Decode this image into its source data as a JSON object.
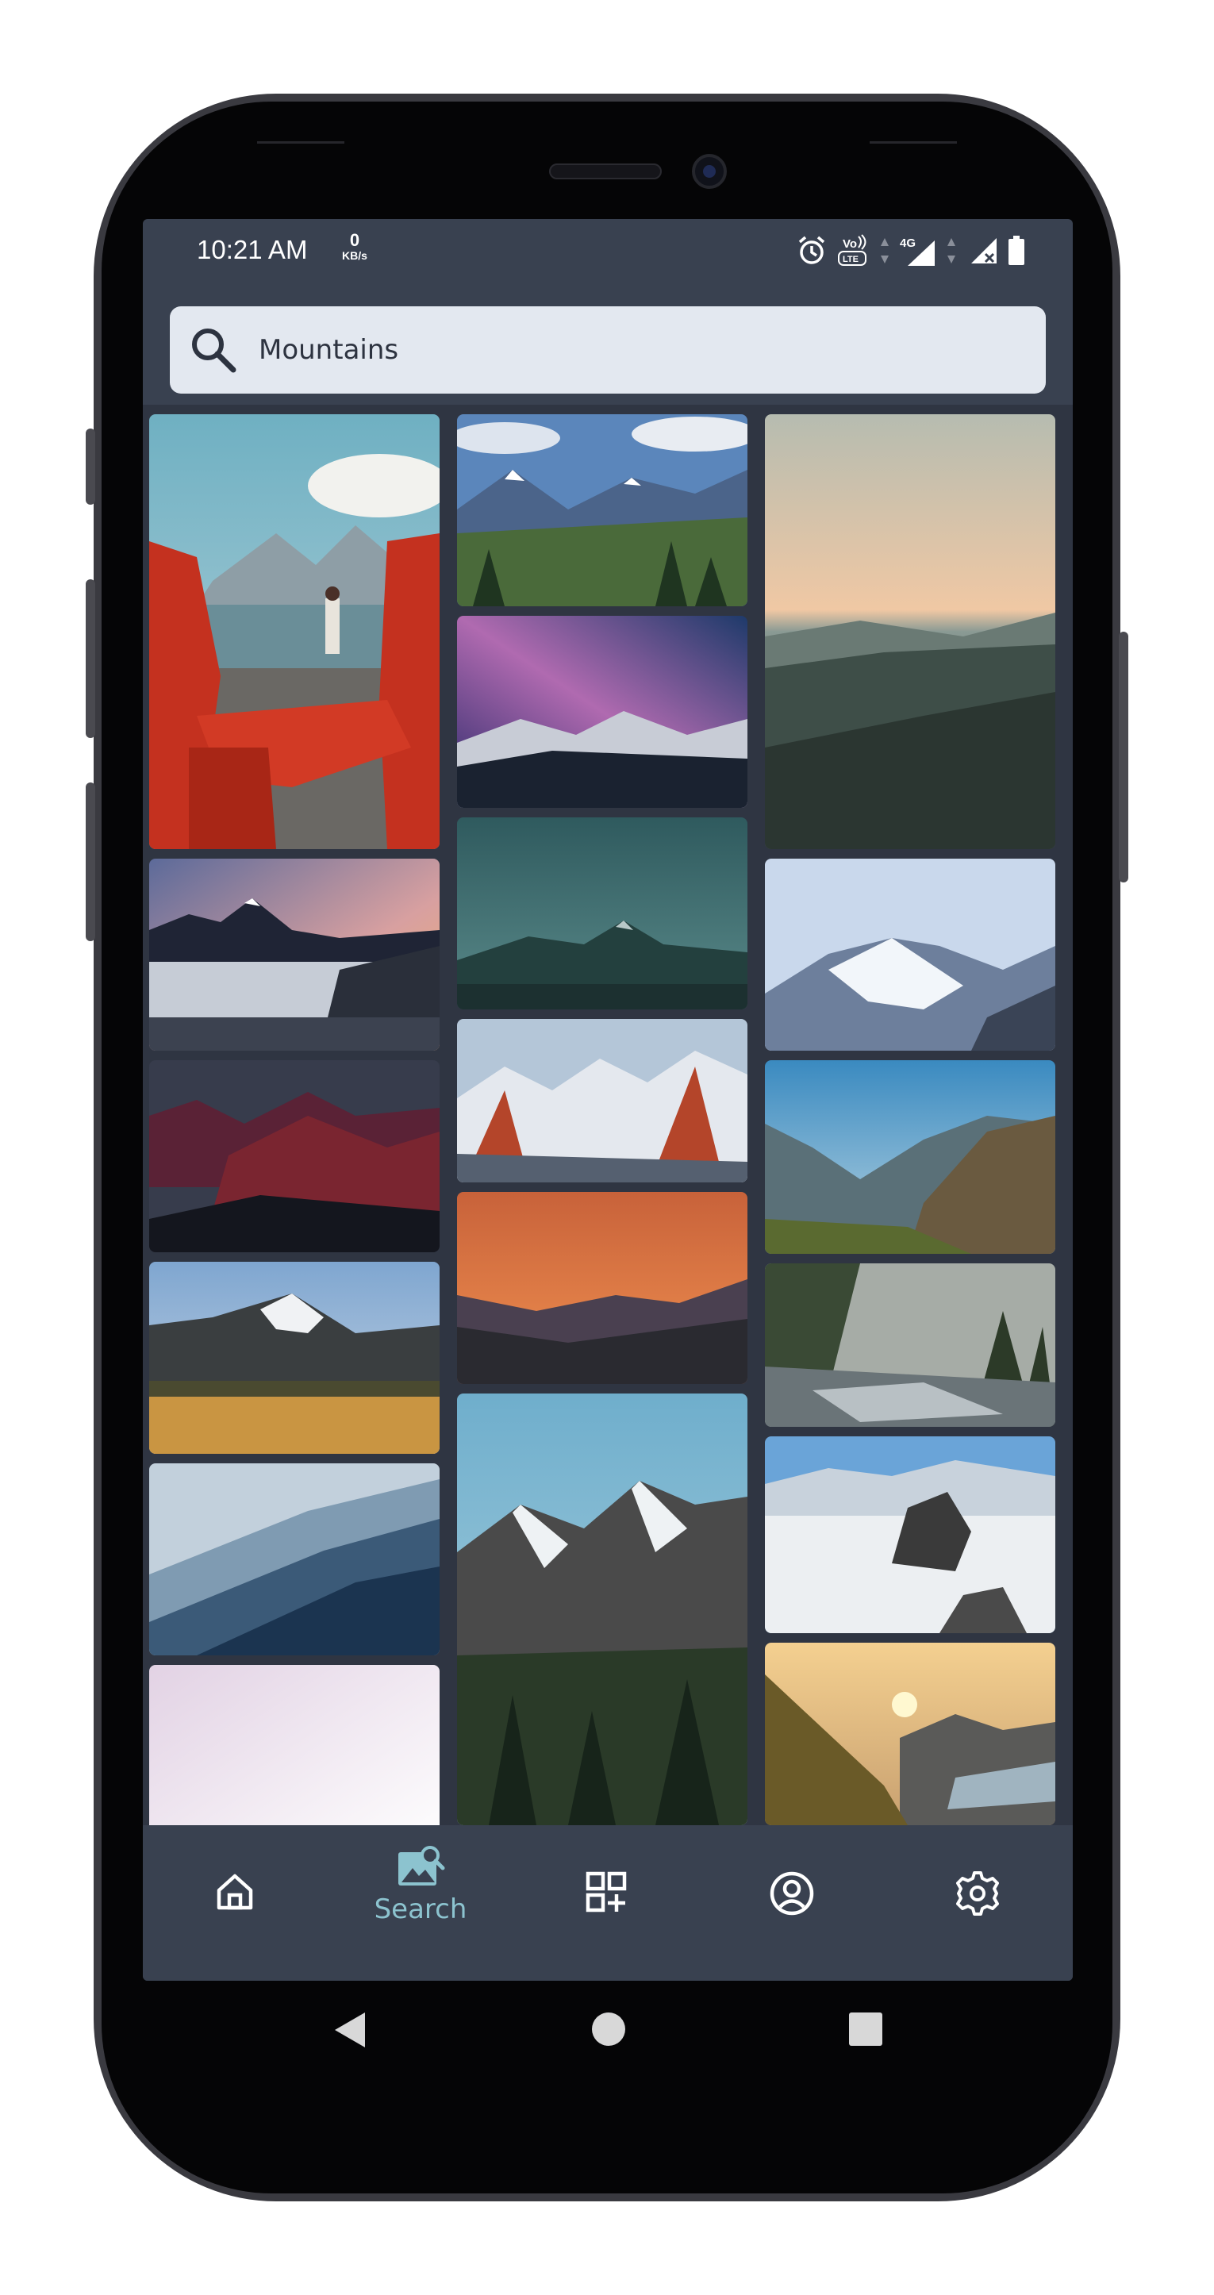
{
  "status_bar": {
    "time": "10:21 AM",
    "data_rate": "0",
    "data_rate_unit": "KB/s",
    "network": "4G"
  },
  "search": {
    "value": "Mountains",
    "placeholder": "Search"
  },
  "results": [
    {
      "id": "canoe-chairs-lake-person",
      "colors": [
        "#7fb3c2",
        "#c9362a"
      ]
    },
    {
      "id": "blue-valley-forest",
      "colors": [
        "#5f8bbf",
        "#2f4a2a"
      ]
    },
    {
      "id": "misty-ridges-sunset",
      "colors": [
        "#e6c3a8",
        "#2c3933"
      ]
    },
    {
      "id": "milky-way-peaks",
      "colors": [
        "#2a3a7a",
        "#1a2230"
      ]
    },
    {
      "id": "sea-of-clouds-dusk",
      "colors": [
        "#c28a8a",
        "#2a3040"
      ]
    },
    {
      "id": "teal-peak",
      "colors": [
        "#3d6a6a",
        "#1c3030"
      ]
    },
    {
      "id": "snowy-himalaya",
      "colors": [
        "#c8d6ea",
        "#5d6f8f"
      ]
    },
    {
      "id": "red-ridges-night",
      "colors": [
        "#3b4050",
        "#6a2030"
      ]
    },
    {
      "id": "red-rock-snow",
      "colors": [
        "#b8c8d8",
        "#b04a2a"
      ]
    },
    {
      "id": "green-valley-sunlit",
      "colors": [
        "#5aa0c8",
        "#6a6040"
      ]
    },
    {
      "id": "orange-sky-peaks",
      "colors": [
        "#e07a45",
        "#2a2a30"
      ]
    },
    {
      "id": "forest-river",
      "colors": [
        "#a0a8a0",
        "#3a4535"
      ]
    },
    {
      "id": "snow-peak-golden-field",
      "colors": [
        "#8fb2d8",
        "#c9963e"
      ]
    },
    {
      "id": "snowy-peak-pines",
      "colors": [
        "#8fc0d8",
        "#2f3a2a"
      ]
    },
    {
      "id": "blue-haze-ridges",
      "colors": [
        "#b0c4d4",
        "#1f3a55"
      ]
    },
    {
      "id": "peaks-above-clouds",
      "colors": [
        "#e8ecf0",
        "#3a3a3a"
      ]
    },
    {
      "id": "pale-pink-sky",
      "colors": [
        "#e6d8e6",
        "#ffffff"
      ]
    },
    {
      "id": "fjord-sunrise",
      "colors": [
        "#f2c27a",
        "#4a5a3a"
      ]
    }
  ],
  "nav": {
    "home_label": "Home",
    "search_label": "Search",
    "collections_label": "Collections",
    "profile_label": "Profile",
    "settings_label": "Settings",
    "active": "search"
  },
  "colors": {
    "screen_bg": "#394150",
    "grid_bg": "#2f3542",
    "search_bg": "#e3e8f0",
    "accent": "#8cc3cf"
  }
}
